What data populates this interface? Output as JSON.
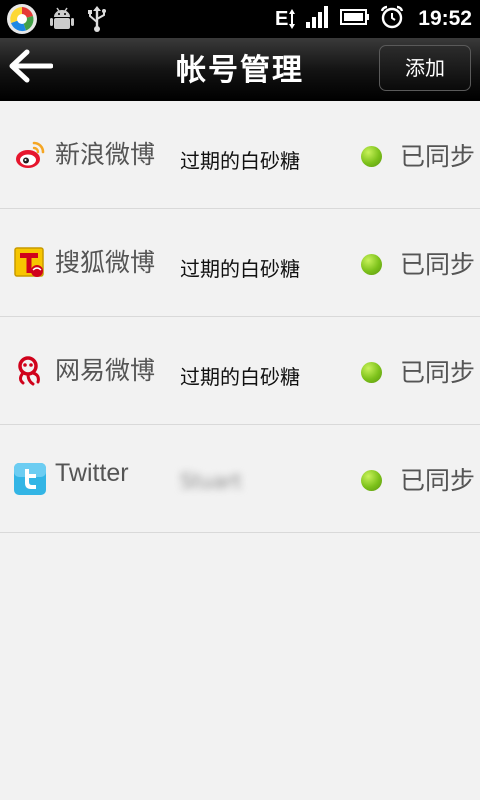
{
  "statusbar": {
    "network": "E",
    "time": "19:52"
  },
  "header": {
    "title": "帐号管理",
    "add_label": "添加"
  },
  "accounts": [
    {
      "service": "新浪微博",
      "account": "过期的白砂糖",
      "status": "已同步",
      "icon": "sina-weibo-icon"
    },
    {
      "service": "搜狐微博",
      "account": "过期的白砂糖",
      "status": "已同步",
      "icon": "sohu-weibo-icon"
    },
    {
      "service": "网易微博",
      "account": "过期的白砂糖",
      "status": "已同步",
      "icon": "netease-weibo-icon"
    },
    {
      "service": "Twitter",
      "account": "Stuart",
      "status": "已同步",
      "icon": "twitter-icon"
    }
  ],
  "colors": {
    "sync_dot": "#7cc11a",
    "header_bg": "#000000",
    "list_bg": "#f2f2f2"
  }
}
